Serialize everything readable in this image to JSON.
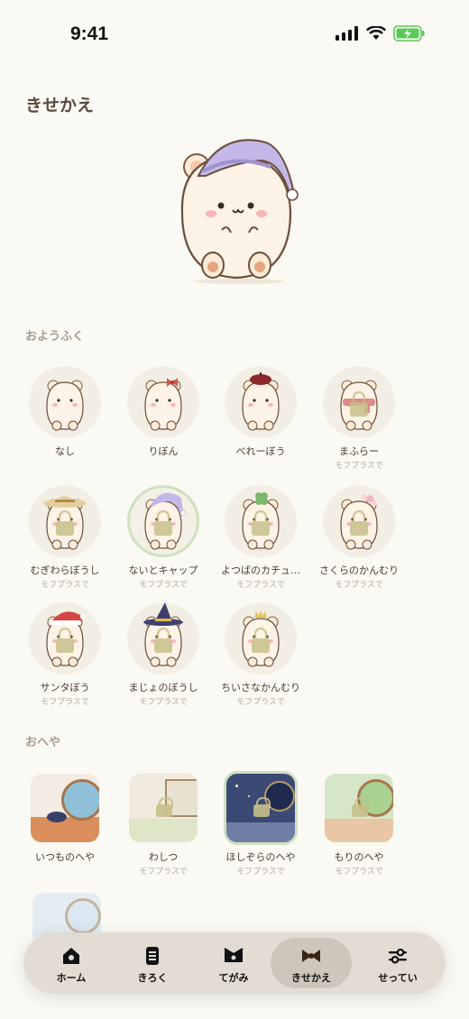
{
  "status": {
    "time": "9:41"
  },
  "page": {
    "title": "きせかえ"
  },
  "sections": {
    "outfits": "おようふく",
    "rooms": "おへや"
  },
  "outfits": [
    {
      "name": "なし",
      "sub": "",
      "hat": "none",
      "locked": false
    },
    {
      "name": "りぼん",
      "sub": "",
      "hat": "ribbon",
      "locked": false
    },
    {
      "name": "べれーぼう",
      "sub": "",
      "hat": "beret",
      "locked": false
    },
    {
      "name": "まふらー",
      "sub": "モフプラスで",
      "hat": "scarf",
      "locked": true
    },
    {
      "name": "むぎわらぼうし",
      "sub": "モフプラスで",
      "hat": "straw",
      "locked": true
    },
    {
      "name": "ないとキャップ",
      "sub": "モフプラスで",
      "hat": "nightcap",
      "locked": true
    },
    {
      "name": "よつばのカチュ…",
      "sub": "モフプラスで",
      "hat": "clover",
      "locked": true
    },
    {
      "name": "さくらのかんむり",
      "sub": "モフプラスで",
      "hat": "sakura",
      "locked": true
    },
    {
      "name": "サンタぼう",
      "sub": "モフプラスで",
      "hat": "santa",
      "locked": true
    },
    {
      "name": "まじょのぼうし",
      "sub": "モフプラスで",
      "hat": "witch",
      "locked": true
    },
    {
      "name": "ちいさなかんむり",
      "sub": "モフプラスで",
      "hat": "crown",
      "locked": true
    }
  ],
  "rooms": [
    {
      "name": "いつものへや",
      "sub": "",
      "theme": "usual",
      "locked": false
    },
    {
      "name": "わしつ",
      "sub": "モフプラスで",
      "theme": "washitsu",
      "locked": true
    },
    {
      "name": "ほしぞらのへや",
      "sub": "モフプラスで",
      "theme": "starry",
      "locked": true
    },
    {
      "name": "もりのへや",
      "sub": "モフプラスで",
      "theme": "forest",
      "locked": true
    }
  ],
  "tabs": [
    {
      "label": "ホーム",
      "icon": "home-icon"
    },
    {
      "label": "きろく",
      "icon": "notebook-icon"
    },
    {
      "label": "てがみ",
      "icon": "letter-icon"
    },
    {
      "label": "きせかえ",
      "icon": "ribbon-icon",
      "active": true
    },
    {
      "label": "せってい",
      "icon": "sliders-icon"
    }
  ],
  "colors": {
    "background": "#fbf9f3",
    "selected_ring": "#cfe1c1",
    "text": "#5a4a3c",
    "sub_text": "#b2a89d"
  }
}
